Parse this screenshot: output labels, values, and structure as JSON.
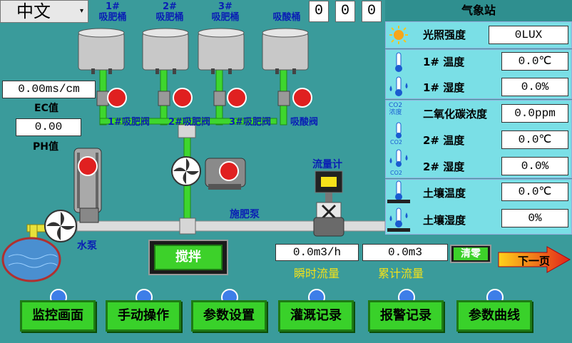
{
  "lang_select": {
    "value": "中文"
  },
  "counters": [
    "0",
    "0",
    "0"
  ],
  "tanks": [
    {
      "label_line1": "1#",
      "label_line2": "吸肥桶"
    },
    {
      "label_line1": "2#",
      "label_line2": "吸肥桶"
    },
    {
      "label_line1": "3#",
      "label_line2": "吸肥桶"
    },
    {
      "label_line1": "",
      "label_line2": "吸酸桶"
    }
  ],
  "valves": [
    "1#吸肥阀",
    "2#吸肥阀",
    "3#吸肥阀",
    "吸酸阀"
  ],
  "ec": {
    "value": "0.00ms/cm",
    "label": "EC值"
  },
  "ph": {
    "value": "0.00",
    "label": "PH值"
  },
  "flowmeter_label": "流量计",
  "pump_label": "施肥泵",
  "water_pump_label": "水泵",
  "stir_label": "搅拌",
  "flow": {
    "instant_value": "0.0m3/h",
    "instant_label": "瞬时流量",
    "total_value": "0.0m3",
    "total_label": "累计流量",
    "clear_label": "清零"
  },
  "next_page_label": "下一页",
  "weather": {
    "title": "气象站",
    "light_label": "光照强度",
    "light_value": "0LUX",
    "temp1_label": "1# 温度",
    "temp1_value": "0.0℃",
    "hum1_label": "1# 湿度",
    "hum1_value": "0.0%",
    "co2_small_label": "CO2\n浓度",
    "co2_label": "二氧化碳浓度",
    "co2_value": "0.0ppm",
    "temp2_label": "2# 温度",
    "temp2_value": "0.0℃",
    "hum2_label": "2# 湿度",
    "hum2_value": "0.0%",
    "co2_tag": "CO2",
    "soil_temp_label": "土壤温度",
    "soil_temp_value": "0.0℃",
    "soil_hum_label": "土壤湿度",
    "soil_hum_value": "0%"
  },
  "nav": [
    {
      "label": "监控画面",
      "icon": "home-icon"
    },
    {
      "label": "手动操作",
      "icon": "gear-icon"
    },
    {
      "label": "参数设置",
      "icon": "settings-doc-icon"
    },
    {
      "label": "灌溉记录",
      "icon": "record-icon"
    },
    {
      "label": "报警记录",
      "icon": "bell-icon"
    },
    {
      "label": "参数曲线",
      "icon": "chart-icon"
    }
  ],
  "colors": {
    "background": "#3a9b9b",
    "pipe": "#3ed62e",
    "nav_button": "#39d12a",
    "weather_panel": "#7adfe6"
  }
}
